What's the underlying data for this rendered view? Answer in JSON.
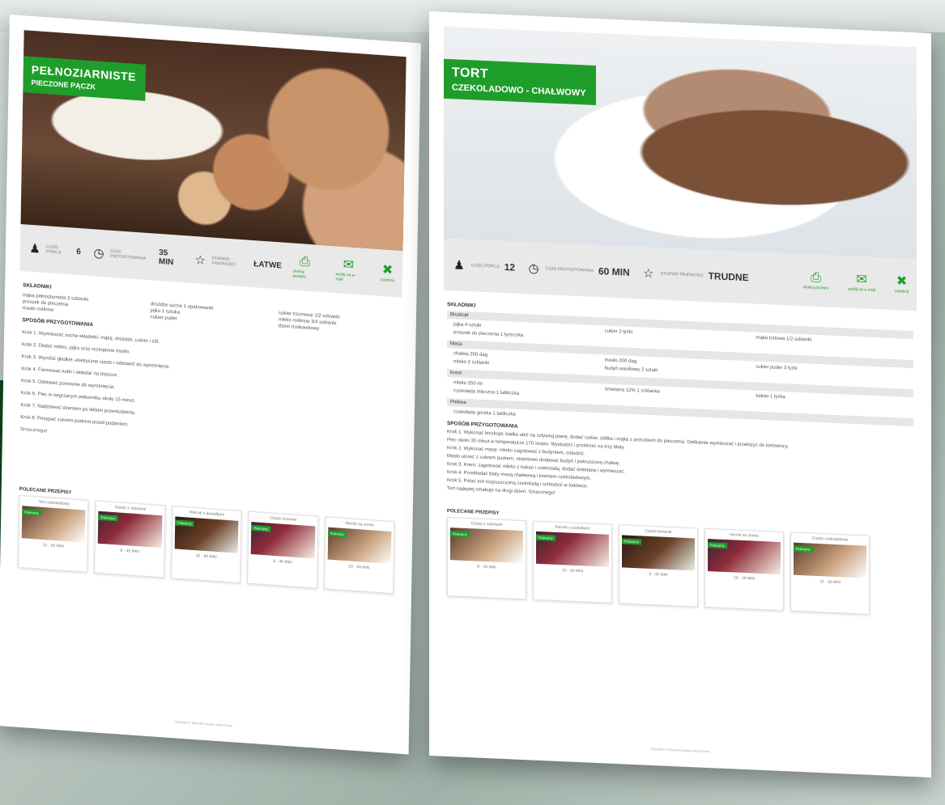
{
  "left": {
    "title_line1": "PEŁNOZIARNISTE",
    "title_line2": "PIECZONE PĄCZK",
    "info": {
      "servings": {
        "icon": "chef-hat-icon",
        "label": "ILOŚĆ PORCJI",
        "value": "6"
      },
      "time": {
        "icon": "clock-icon",
        "label": "CZAS PRZYGOTOWANIA",
        "value": "35 MIN"
      },
      "difficulty": {
        "icon": "star-icon",
        "label": "STOPIEŃ TRUDNOŚCI",
        "value": "ŁATWE"
      }
    },
    "actions": {
      "print": "drukuj przepis",
      "email": "wyślij na e-mail",
      "close": "zamknij"
    },
    "ingredients_title": "SKŁADNIKI",
    "ingredients": [
      [
        "mąka pełnoziarnista 2 szklanki",
        "cukier trzcinowy 1/2 szklanki",
        "mleko roślinne 3/4 szklanki"
      ],
      [
        "drożdże suche 1 opakowanie",
        "jajko 1 sztuka",
        "dżem truskawkowy"
      ],
      [
        "proszek do pieczenia",
        "masło roślinne",
        "cukier puder"
      ]
    ],
    "method_title": "SPOSÓB PRZYGOTOWANIA",
    "steps": [
      "Krok 1. Wymieszać suche składniki: mąkę, drożdże, cukier i sól.",
      "Krok 2. Dodać mleko, jajko oraz roztopione masło.",
      "Krok 3. Wyrobić gładkie, elastyczne ciasto i odstawić do wyrośnięcia.",
      "Krok 4. Formować kulki i układać na blaszce.",
      "Krok 5. Odstawić ponownie do wyrośnięcia.",
      "Krok 6. Piec w nagrzanym piekarniku około 15 minut.",
      "Krok 7. Nadziewać dżemem po lekkim przestudzeniu.",
      "Krok 8. Posypać cukrem pudrem przed podaniem."
    ],
    "note": "Smacznego!",
    "related_title": "POLECANE PRZEPISY",
    "related": [
      {
        "title": "Tort czekoladowy",
        "badge": "Polecamy",
        "meta": "12 · 60 MIN"
      },
      {
        "title": "Ciasto z wiśniami",
        "badge": "Polecamy",
        "meta": "8 · 45 MIN"
      },
      {
        "title": "Piernik z powidłami",
        "badge": "Polecamy",
        "meta": "10 · 90 MIN"
      },
      {
        "title": "Ciasto brownie",
        "badge": "Polecamy",
        "meta": "8 · 40 MIN"
      },
      {
        "title": "Sernik na zimno",
        "badge": "Polecamy",
        "meta": "10 · 30 MIN"
      }
    ],
    "footer": "Copyright © Wszelkie prawa zastrzeżone"
  },
  "right": {
    "title_line1": "TORT",
    "title_line2": "CZEKOLADOWO - CHAŁWOWY",
    "info": {
      "servings": {
        "icon": "chef-hat-icon",
        "label": "ILOŚĆ PORCJI",
        "value": "12"
      },
      "time": {
        "icon": "clock-icon",
        "label": "CZAS PRZYGOTOWANIA",
        "value": "60 MIN"
      },
      "difficulty": {
        "icon": "star-icon",
        "label": "STOPIEŃ TRUDNOŚCI",
        "value": "TRUDNE"
      }
    },
    "actions": {
      "print": "drukuj przepis",
      "email": "wyślij na e-mail",
      "close": "zamknij"
    },
    "ingredients_title": "SKŁADNIKI",
    "groups": [
      {
        "name": "Biszkopt",
        "rows": [
          [
            "jajka 4 sztuki",
            "cukier 2 łyżki",
            "mąka tortowa 1/2 szklanki"
          ],
          [
            "proszek do pieczenia 1 łyżeczka",
            "",
            ""
          ]
        ]
      },
      {
        "name": "Masa",
        "rows": [
          [
            "chałwa 200 dag",
            "masło 200 dag",
            "cukier puder 3 łyżki"
          ],
          [
            "mleko 2 szklanki",
            "budyń waniliowy 2 sztuki",
            ""
          ]
        ]
      },
      {
        "name": "Krem",
        "rows": [
          [
            "mleko 250 ml",
            "śmietana 12% 1 szklanka",
            "kakao 1 łyżka"
          ],
          [
            "czekolada mleczna 1 tabliczka",
            "",
            ""
          ]
        ]
      },
      {
        "name": "Polewa",
        "rows": [
          [
            "czekolada gorzka 1 tabliczka",
            "",
            ""
          ]
        ]
      }
    ],
    "method_title": "SPOSÓB PRZYGOTOWANIA",
    "steps": [
      "Krok 1. Wykonać biszkopt: białka ubić na sztywną pianę, dodać cukier, żółtka i mąkę z proszkiem do pieczenia. Delikatnie wymieszać i przełożyć do tortownicy.",
      "Piec około 30 minut w temperaturze 170 stopni. Wystudzić i przekroić na trzy blaty.",
      "Krok 2. Wykonać masę: mleko zagotować z budyniem, ostudzić.",
      "Masło utrzeć z cukrem pudrem, stopniowo dodawać budyń i pokruszoną chałwę.",
      "Krok 3. Krem: zagotować mleko z kakao i czekoladą, dodać śmietanę i wymieszać.",
      "Krok 4. Przekładać blaty masą chałwową i kremem czekoladowym.",
      "Krok 5. Polać tort rozpuszczoną czekoladą i schłodzić w lodówce.",
      "Tort najlepiej smakuje na drugi dzień. Smacznego!"
    ],
    "related_title": "POLECANE PRZEPISY",
    "related": [
      {
        "title": "Ciasto z wiśniami",
        "badge": "Polecamy",
        "meta": "8 · 45 MIN"
      },
      {
        "title": "Piernik z powidłami",
        "badge": "Polecamy",
        "meta": "10 · 90 MIN"
      },
      {
        "title": "Ciasto brownie",
        "badge": "Polecamy",
        "meta": "8 · 40 MIN"
      },
      {
        "title": "Sernik na zimno",
        "badge": "Polecamy",
        "meta": "10 · 30 MIN"
      },
      {
        "title": "Ciasto czekoladowe",
        "badge": "Polecamy",
        "meta": "12 · 60 MIN"
      }
    ],
    "footer": "Copyright © Wszelkie prawa zastrzeżone"
  }
}
